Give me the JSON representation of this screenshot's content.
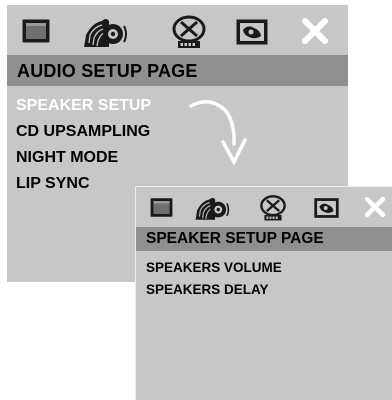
{
  "audio_setup": {
    "icons": [
      "general-setup-icon",
      "audio-setup-icon",
      "video-setup-icon",
      "preference-setup-icon",
      "exit-icon"
    ],
    "title": "AUDIO SETUP PAGE",
    "items": [
      {
        "label": "SPEAKER SETUP",
        "selected": true
      },
      {
        "label": "CD UPSAMPLING",
        "selected": false
      },
      {
        "label": "NIGHT MODE",
        "selected": false
      },
      {
        "label": "LIP SYNC",
        "selected": false
      }
    ]
  },
  "speaker_setup": {
    "icons": [
      "general-setup-icon",
      "audio-setup-icon",
      "video-setup-icon",
      "preference-setup-icon",
      "exit-icon"
    ],
    "title": "SPEAKER SETUP PAGE",
    "items": [
      {
        "label": "SPEAKERS VOLUME"
      },
      {
        "label": "SPEAKERS DELAY"
      }
    ]
  },
  "colors": {
    "panel_bg": "#c7c7c7",
    "title_bar": "#8f8f8f",
    "selected_text": "#ffffff",
    "text": "#000000"
  }
}
